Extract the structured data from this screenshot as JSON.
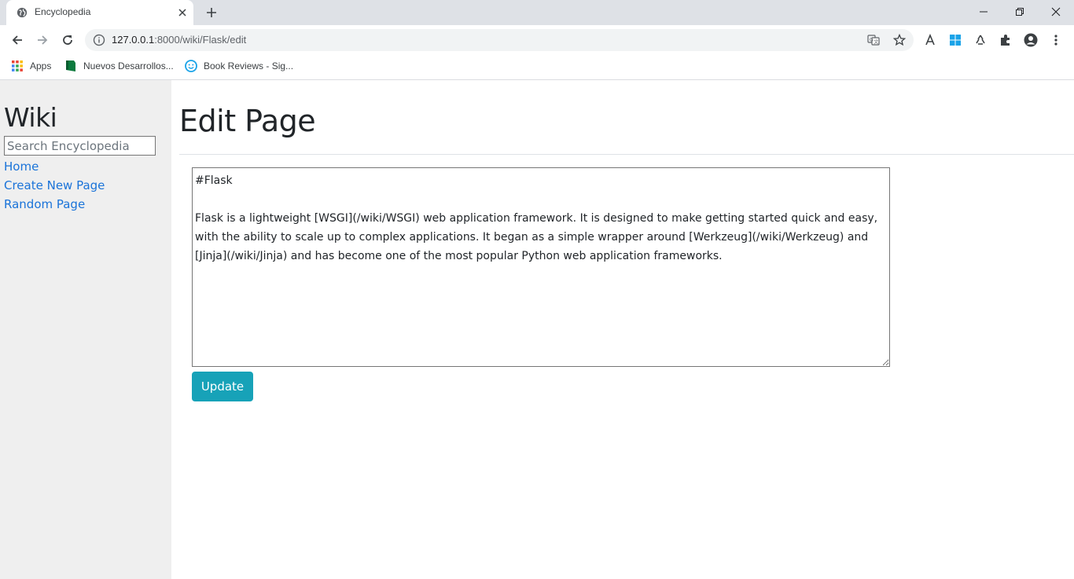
{
  "browser": {
    "tab_title": "Encyclopedia",
    "url_host": "127.0.0.1",
    "url_rest": ":8000/wiki/Flask/edit",
    "bookmarks": [
      {
        "label": "Apps",
        "icon": "apps-grid-icon"
      },
      {
        "label": "Nuevos Desarrollos...",
        "icon": "bookmark-flag-icon"
      },
      {
        "label": "Book Reviews - Sig...",
        "icon": "bookmark-face-icon"
      }
    ]
  },
  "sidebar": {
    "logo": "Wiki",
    "search_placeholder": "Search Encyclopedia",
    "links": [
      {
        "label": "Home"
      },
      {
        "label": "Create New Page"
      },
      {
        "label": "Random Page"
      }
    ]
  },
  "main": {
    "heading": "Edit Page",
    "content": "#Flask\n\nFlask is a lightweight [WSGI](/wiki/WSGI) web application framework. It is designed to make getting started quick and easy, with the ability to scale up to complex applications. It began as a simple wrapper around [Werkzeug](/wiki/Werkzeug) and [Jinja](/wiki/Jinja) and has become one of the most popular Python web application frameworks.",
    "submit_label": "Update"
  },
  "colors": {
    "link": "#1a73d9",
    "button": "#17a2b8",
    "sidebar_bg": "#efefef"
  }
}
